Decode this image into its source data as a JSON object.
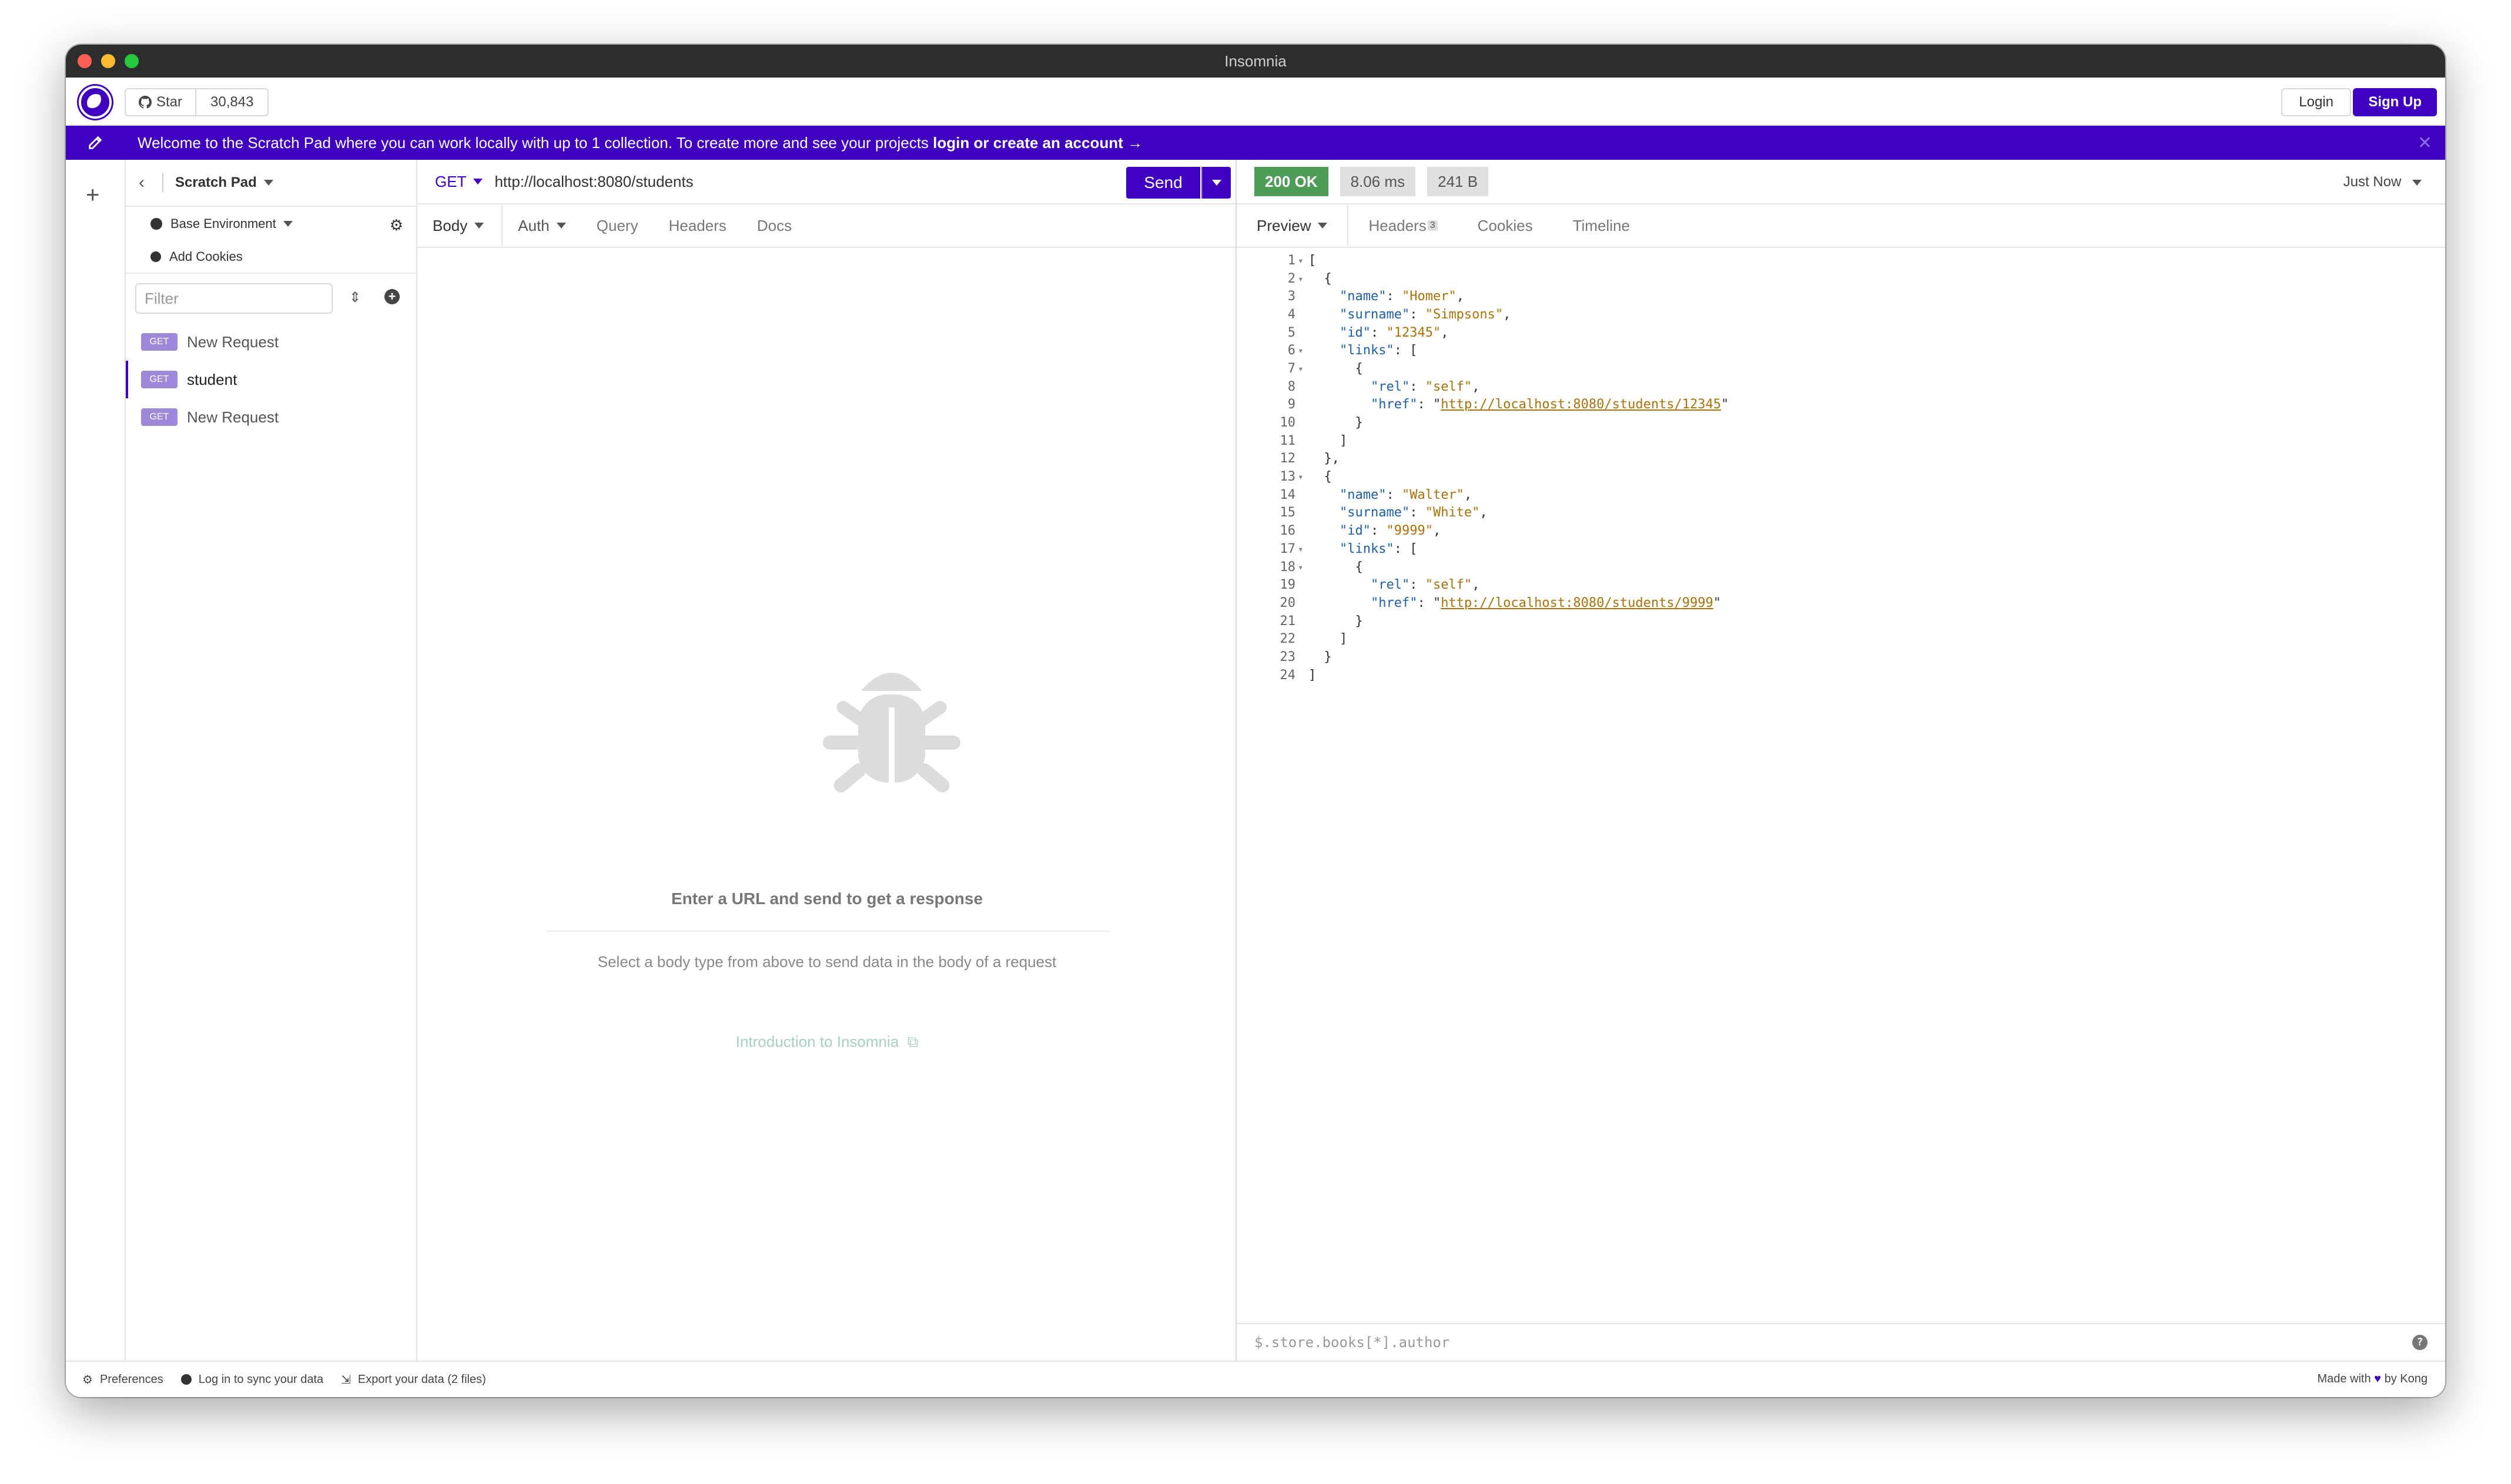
{
  "window": {
    "title": "Insomnia"
  },
  "header": {
    "github_star_label": "Star",
    "github_star_count": "30,843",
    "login_label": "Login",
    "signup_label": "Sign Up"
  },
  "banner": {
    "text_prefix": "Welcome to the Scratch Pad where you can work locally with up to 1 collection. To create more and see your projects ",
    "text_link": "login or create an account →",
    "close_label": "✕"
  },
  "sidebar": {
    "title": "Scratch Pad",
    "environment": "Base Environment",
    "add_cookies": "Add Cookies",
    "filter_placeholder": "Filter",
    "requests": [
      {
        "method": "GET",
        "name": "New Request"
      },
      {
        "method": "GET",
        "name": "student"
      },
      {
        "method": "GET",
        "name": "New Request"
      }
    ]
  },
  "request": {
    "method": "GET",
    "url": "http://localhost:8080/students",
    "send_label": "Send",
    "tabs": [
      "Body",
      "Auth",
      "Query",
      "Headers",
      "Docs"
    ],
    "empty_title": "Enter a URL and send to get a response",
    "empty_sub": "Select a body type from above to send data in the body of a request",
    "empty_link": "Introduction to Insomnia"
  },
  "response": {
    "status": "200 OK",
    "time": "8.06 ms",
    "size": "241 B",
    "when": "Just Now",
    "tabs": [
      "Preview",
      "Headers",
      "Cookies",
      "Timeline"
    ],
    "headers_count": "3",
    "filter_placeholder": "$.store.books[*].author",
    "help_label": "?",
    "lines": [
      "[",
      "  {",
      "    \"name\": \"Homer\",",
      "    \"surname\": \"Simpsons\",",
      "    \"id\": \"12345\",",
      "    \"links\": [",
      "      {",
      "        \"rel\": \"self\",",
      "        \"href\": \"http://localhost:8080/students/12345\"",
      "      }",
      "    ]",
      "  },",
      "  {",
      "    \"name\": \"Walter\",",
      "    \"surname\": \"White\",",
      "    \"id\": \"9999\",",
      "    \"links\": [",
      "      {",
      "        \"rel\": \"self\",",
      "        \"href\": \"http://localhost:8080/students/9999\"",
      "      }",
      "    ]",
      "  }",
      "]"
    ]
  },
  "footer": {
    "preferences": "Preferences",
    "sync": "Log in to sync your data",
    "export": "Export your data (2 files)",
    "made_with_prefix": "Made with",
    "made_with_suffix": "by Kong"
  },
  "colors": {
    "brand": "#4000bf",
    "status_ok": "#4f9c59",
    "get_badge": "#9e88d9"
  }
}
